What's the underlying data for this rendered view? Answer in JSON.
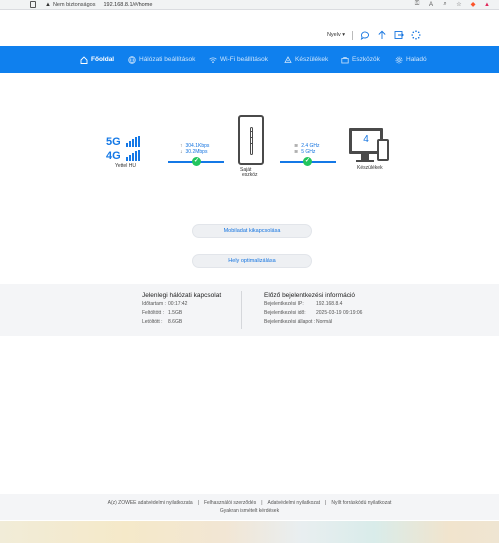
{
  "browser": {
    "security_label": "Nem biztonságos",
    "url": "192.168.8.1/#/home"
  },
  "utility": {
    "language": "Nyelv"
  },
  "nav": {
    "items": [
      {
        "label": "Főoldal",
        "icon": "home-icon",
        "active": true
      },
      {
        "label": "Hálózati beállítások",
        "icon": "globe-icon"
      },
      {
        "label": "Wi-Fi beállítások",
        "icon": "wifi-icon"
      },
      {
        "label": "Készülékek",
        "icon": "devices-icon"
      },
      {
        "label": "Eszközök",
        "icon": "toolbox-icon"
      },
      {
        "label": "Haladó",
        "icon": "gear-icon"
      }
    ]
  },
  "topology": {
    "network": {
      "gen_top": "5G",
      "gen_bottom": "4G",
      "operator": "Yettel HU"
    },
    "upload": "304.1Kbps",
    "download": "30.2Mbps",
    "device_label_line1": "Saját",
    "device_label_line2": "eszköz",
    "band_1": "2.4 GHz",
    "band_2": "5 GHz",
    "clients_count": "4",
    "clients_label": "Készülékek"
  },
  "actions": {
    "mobile_data_button": "Mobiladat kikapcsolása",
    "optimize_button": "Hely optimalizálása"
  },
  "current_connection": {
    "title": "Jelenlegi hálózati kapcsolat",
    "duration_label": "Időtartam :",
    "duration_value": "00:17:42",
    "uploaded_label": "Feltöltött :",
    "uploaded_value": "1.5GB",
    "downloaded_label": "Letöltött :",
    "downloaded_value": "8.6GB"
  },
  "previous_login": {
    "title": "Előző bejelentkezési információ",
    "ip_label": "Bejelentkezési IP:",
    "ip_value": "192.168.8.4",
    "time_label": "Bejelentkezési idő:",
    "time_value": "2025-03-19 09:19:06",
    "status_label": "Bejelentkezési állapot :",
    "status_value": "Normál"
  },
  "footer": {
    "privacy_zowee": "A(z) ZOWEE adatvédelmi nyilatkozata",
    "user_agreement": "Felhasználói szerződés",
    "privacy": "Adatvédelmi nyilatkozat",
    "open_source": "Nyílt forráskódú nyilatkozat",
    "faq": "Gyakran ismételt kérdések"
  },
  "colors": {
    "brand": "#0f80ee",
    "accent": "#1474e0",
    "ok": "#22c55e"
  }
}
